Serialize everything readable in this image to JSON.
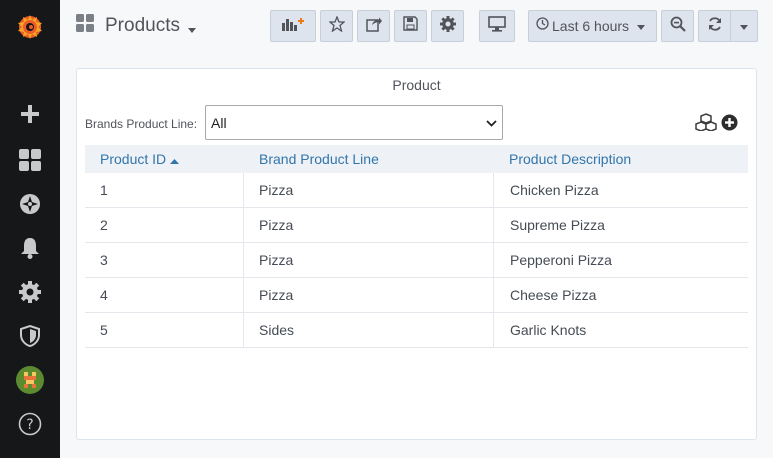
{
  "dashboard": {
    "title": "Products"
  },
  "toolbar": {
    "time_range": "Last 6 hours"
  },
  "panel": {
    "title": "Product",
    "filter": {
      "label": "Brands Product Line:",
      "selected": "All"
    },
    "table": {
      "columns": [
        "Product ID",
        "Brand Product Line",
        "Product Description"
      ],
      "sort_column": "Product ID",
      "sort_direction": "ascending",
      "rows": [
        {
          "id": "1",
          "line": "Pizza",
          "desc": "Chicken Pizza"
        },
        {
          "id": "2",
          "line": "Pizza",
          "desc": "Supreme Pizza"
        },
        {
          "id": "3",
          "line": "Pizza",
          "desc": "Pepperoni Pizza"
        },
        {
          "id": "4",
          "line": "Pizza",
          "desc": "Cheese Pizza"
        },
        {
          "id": "5",
          "line": "Sides",
          "desc": "Garlic Knots"
        }
      ]
    }
  },
  "colors": {
    "sidebar_bg": "#161719",
    "logo_orange": "#f05a28",
    "link_blue": "#3275aa",
    "button_bg": "#dde4ed"
  },
  "icons": {
    "sidebar": [
      "grafana-logo-icon",
      "plus-icon",
      "dashboards-grid-icon",
      "compass-icon",
      "bell-icon",
      "gear-icon",
      "shield-icon",
      "user-avatar-icon",
      "help-icon"
    ],
    "toolbar": [
      "add-panel-icon",
      "star-icon",
      "share-icon",
      "save-icon",
      "settings-gear-icon",
      "tv-monitor-icon",
      "clock-icon",
      "zoom-out-icon",
      "refresh-icon",
      "caret-down-icon"
    ]
  }
}
